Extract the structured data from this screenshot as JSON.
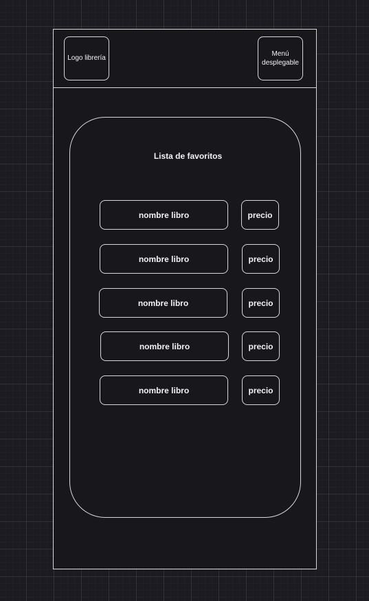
{
  "header": {
    "logo_label": "Logo librería",
    "menu_label": "Menú desplegable"
  },
  "favorites": {
    "title": "Lista de favoritos",
    "items": [
      {
        "name": "nombre libro",
        "price": "precio"
      },
      {
        "name": "nombre libro",
        "price": "precio"
      },
      {
        "name": "nombre libro",
        "price": "precio"
      },
      {
        "name": "nombre libro",
        "price": "precio"
      },
      {
        "name": "nombre libro",
        "price": "precio"
      }
    ]
  },
  "colors": {
    "background": "#1c1b21",
    "stroke": "#d9d9d9",
    "text": "#f2f2f2"
  }
}
